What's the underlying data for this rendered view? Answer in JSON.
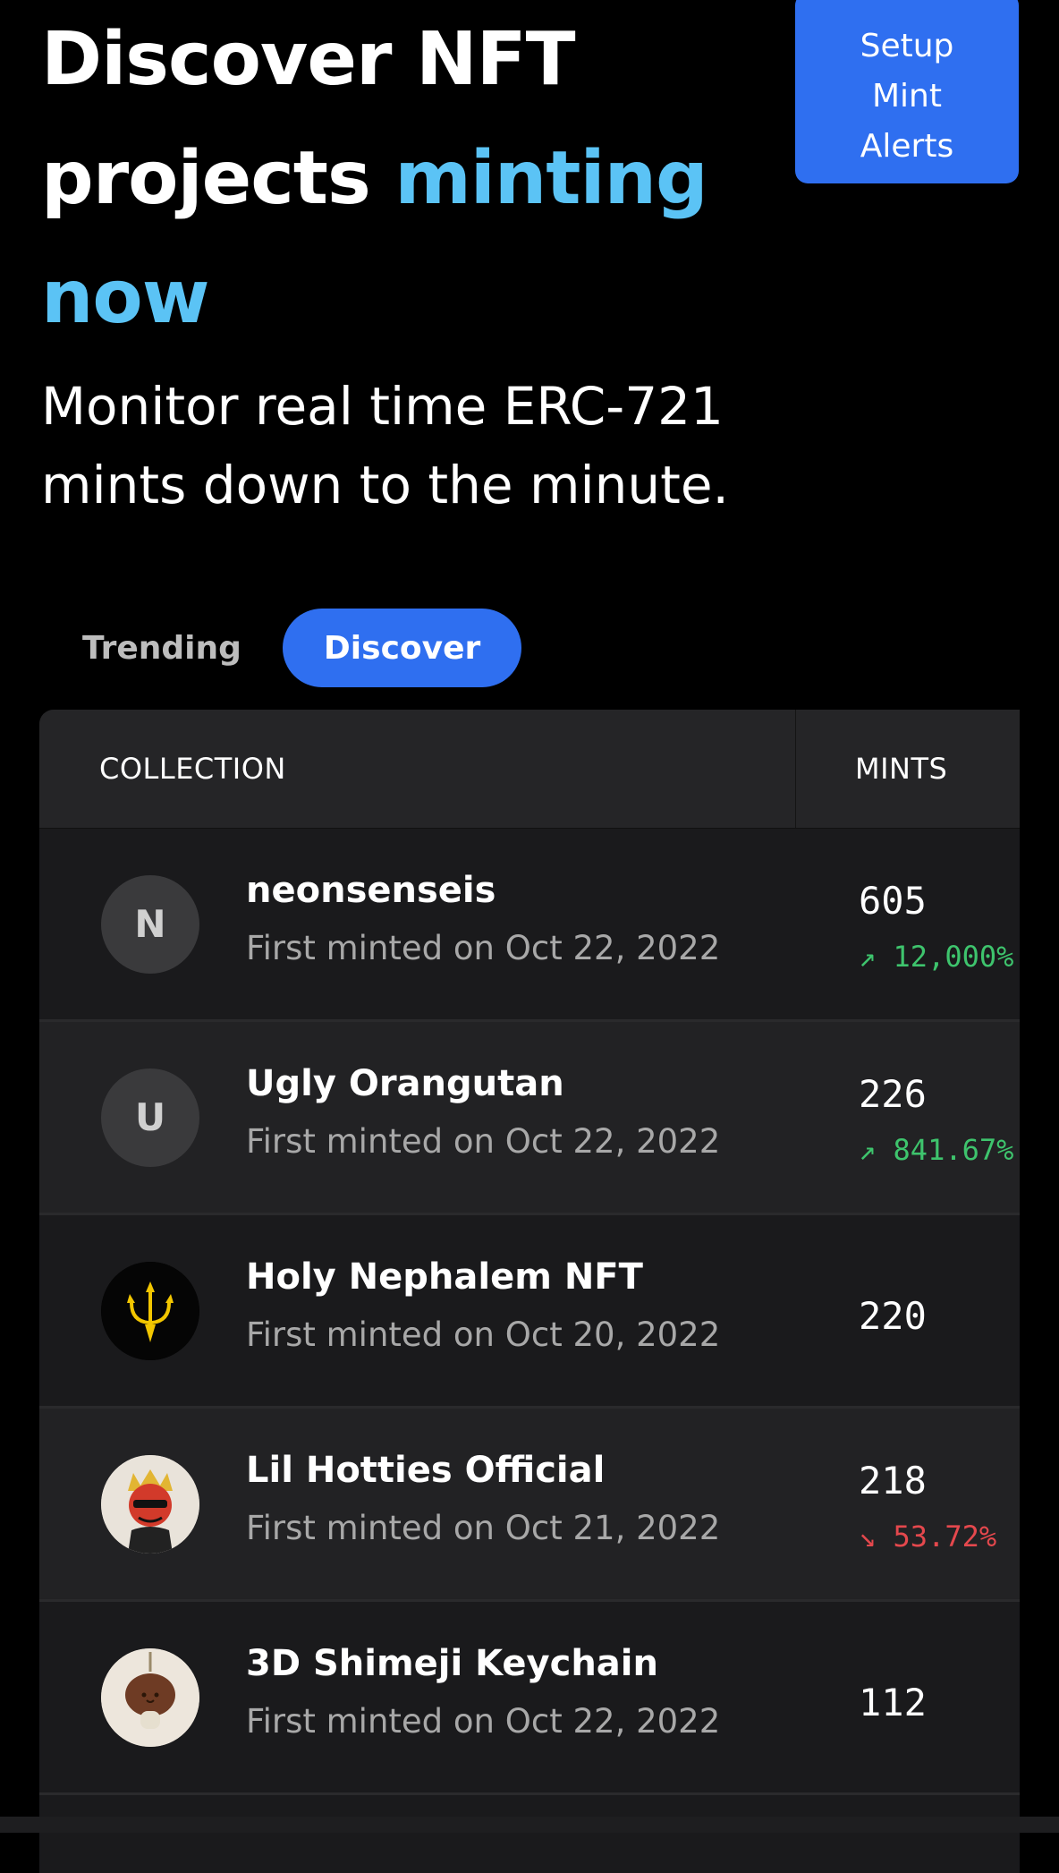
{
  "hero": {
    "title_part1": "Discover NFT projects ",
    "title_accent": "minting now",
    "subtitle": "Monitor real time ERC-721 mints down to the minute."
  },
  "setup_button": {
    "label": "Setup\nMint\nAlerts"
  },
  "colors": {
    "accent_text": "#5BC3F5",
    "primary_blue": "#2F6FF0",
    "up": "#3EC46D",
    "down": "#E5484D"
  },
  "tabs": [
    {
      "label": "Trending",
      "active": false
    },
    {
      "label": "Discover",
      "active": true
    }
  ],
  "table": {
    "headers": {
      "collection": "COLLECTION",
      "mints": "MINTS"
    },
    "rows": [
      {
        "initial": "N",
        "name": "neonsenseis",
        "date": "First minted on Oct 22, 2022",
        "mints": "605",
        "change": "↗ 12,000%",
        "direction": "up"
      },
      {
        "initial": "U",
        "name": "Ugly Orangutan",
        "date": "First minted on Oct 22, 2022",
        "mints": "226",
        "change": "↗ 841.67%",
        "direction": "up"
      },
      {
        "icon": "trident-icon",
        "name": "Holy Nephalem NFT",
        "date": "First minted on Oct 20, 2022",
        "mints": "220",
        "change": "",
        "direction": ""
      },
      {
        "icon": "devil-avatar-icon",
        "name": "Lil Hotties Official",
        "date": "First minted on Oct 21, 2022",
        "mints": "218",
        "change": "↘ 53.72%",
        "direction": "down"
      },
      {
        "icon": "mushroom-keychain-icon",
        "name": "3D Shimeji Keychain",
        "date": "First minted on Oct 22, 2022",
        "mints": "112",
        "change": "",
        "direction": ""
      }
    ]
  }
}
